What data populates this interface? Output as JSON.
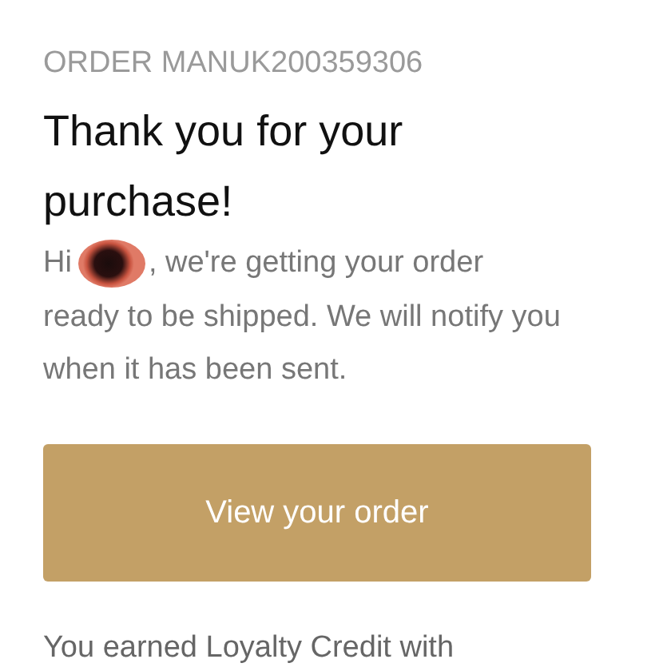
{
  "order_number": "ORDER MANUK200359306",
  "heading": "Thank you for your purchase!",
  "greeting": "Hi",
  "message_start": ", we're getting your order",
  "message_rest": "ready to be shipped. We will notify you when it has been sent.",
  "button": {
    "label": "View your order"
  },
  "loyalty_text": "You earned Loyalty Credit with"
}
